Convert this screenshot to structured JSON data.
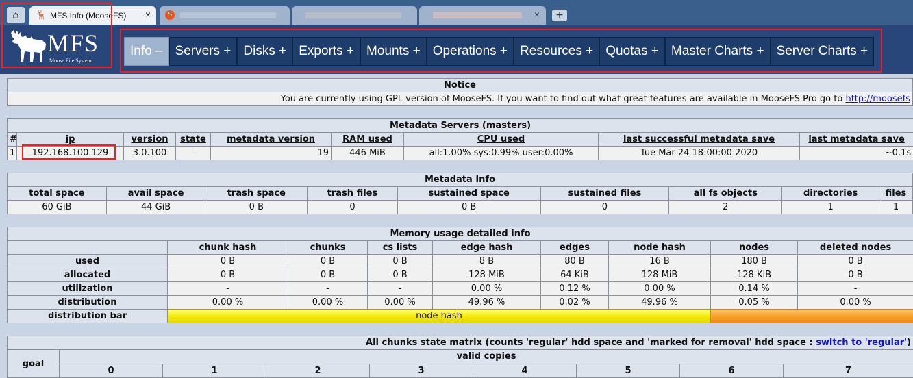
{
  "browser": {
    "home_icon": "home-icon",
    "tabs": [
      {
        "title": "MFS Info (MooseFS)",
        "active": true,
        "close": "×"
      },
      {
        "title": "",
        "active": false
      },
      {
        "title": "",
        "active": false
      },
      {
        "title": "",
        "active": false,
        "close": "×"
      }
    ],
    "new_tab": "+"
  },
  "logo": {
    "text": "MFS",
    "subtitle": "Moose File System"
  },
  "nav": [
    {
      "label": "Info –",
      "active": true
    },
    {
      "label": "Servers +"
    },
    {
      "label": "Disks +"
    },
    {
      "label": "Exports +"
    },
    {
      "label": "Mounts +"
    },
    {
      "label": "Operations +"
    },
    {
      "label": "Resources +"
    },
    {
      "label": "Quotas +"
    },
    {
      "label": "Master Charts +"
    },
    {
      "label": "Server Charts +"
    }
  ],
  "notice": {
    "title": "Notice",
    "text": "You are currently using GPL version of MooseFS. If you want to find out what great features are available in MooseFS Pro go to",
    "link": "http://moosefs"
  },
  "masters": {
    "title": "Metadata Servers (masters)",
    "headers": [
      "#",
      "ip",
      "version",
      "state",
      "metadata version",
      "RAM used",
      "CPU used",
      "last successful metadata save",
      "last metadata save"
    ],
    "row": [
      "1",
      "192.168.100.129",
      "3.0.100",
      "-",
      "19",
      "446 MiB",
      "all:1.00% sys:0.99% user:0.00%",
      "Tue Mar 24 18:00:00 2020",
      "~0.1s"
    ]
  },
  "metadata_info": {
    "title": "Metadata Info",
    "headers": [
      "total space",
      "avail space",
      "trash space",
      "trash files",
      "sustained space",
      "sustained files",
      "all fs objects",
      "directories",
      "files"
    ],
    "row": [
      "60 GiB",
      "44 GiB",
      "0 B",
      "0",
      "0 B",
      "0",
      "2",
      "1",
      "1"
    ]
  },
  "memory": {
    "title": "Memory usage detailed info",
    "headers": [
      "chunk hash",
      "chunks",
      "cs lists",
      "edge hash",
      "edges",
      "node hash",
      "nodes",
      "deleted nodes"
    ],
    "rows": [
      {
        "label": "used",
        "values": [
          "0 B",
          "0 B",
          "0 B",
          "8 B",
          "80 B",
          "16 B",
          "180 B",
          "0 B"
        ]
      },
      {
        "label": "allocated",
        "values": [
          "0 B",
          "0 B",
          "0 B",
          "128 MiB",
          "64 KiB",
          "128 MiB",
          "128 KiB",
          "0 B"
        ]
      },
      {
        "label": "utilization",
        "values": [
          "-",
          "-",
          "-",
          "0.00 %",
          "0.12 %",
          "0.00 %",
          "0.14 %",
          "-"
        ]
      },
      {
        "label": "distribution",
        "values": [
          "0.00 %",
          "0.00 %",
          "0.00 %",
          "49.96 %",
          "0.02 %",
          "49.96 %",
          "0.05 %",
          "0.00 %"
        ]
      }
    ],
    "bar_label": "distribution bar",
    "bar_text": "node hash",
    "bar_colors": {
      "node_hash": "#f3e90a",
      "edge_hash": "#f7a02a"
    }
  },
  "chunks": {
    "title_prefix": "All chunks state matrix (counts 'regular' hdd space and 'marked for removal' hdd space :",
    "switch_link": "switch to 'regular'",
    "title_suffix": ")",
    "goal_label": "goal",
    "valid_copies": "valid copies",
    "copies": [
      "0",
      "1",
      "2",
      "3",
      "4",
      "5",
      "6",
      "7"
    ]
  },
  "colors": {
    "header_bg": "#28467a",
    "page_bg": "#c9d5e5",
    "annotation": "#ff1a1a"
  }
}
